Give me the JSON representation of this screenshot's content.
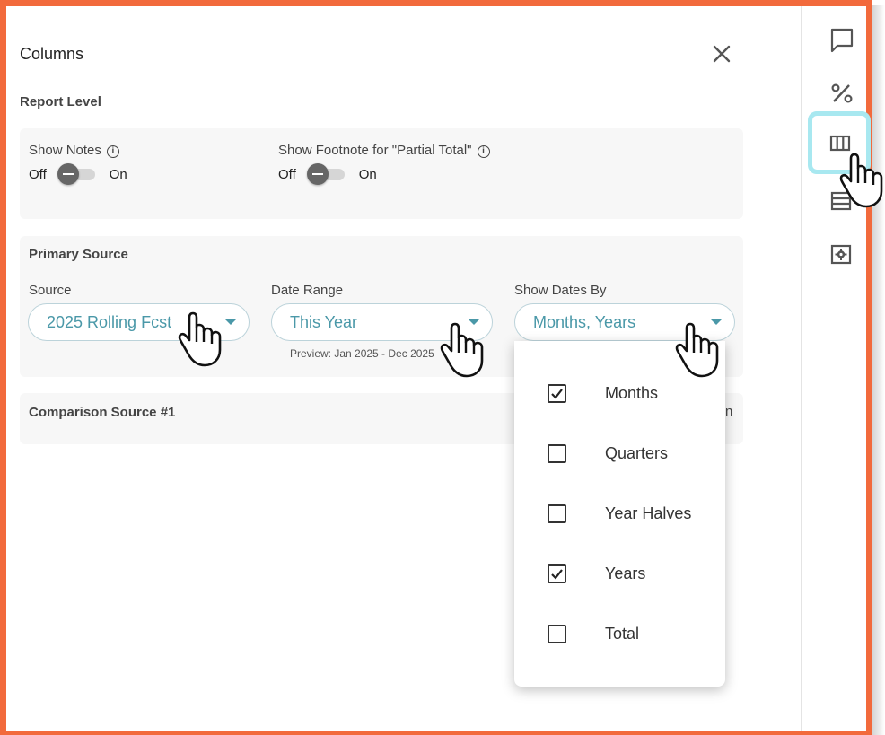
{
  "panel": {
    "title": "Columns",
    "close_icon": "close-icon"
  },
  "report_level": {
    "label": "Report Level",
    "show_notes": {
      "label": "Show Notes",
      "off_label": "Off",
      "on_label": "On",
      "state": "off"
    },
    "show_footnote": {
      "label": "Show Footnote for \"Partial Total\"",
      "off_label": "Off",
      "on_label": "On",
      "state": "off"
    }
  },
  "primary_source": {
    "label": "Primary Source",
    "source": {
      "label": "Source",
      "value": "2025 Rolling Fcst"
    },
    "date_range": {
      "label": "Date Range",
      "value": "This Year",
      "preview": "Preview: Jan 2025 - Dec 2025"
    },
    "show_dates_by": {
      "label": "Show Dates By",
      "value": "Months, Years"
    }
  },
  "comparison_source": {
    "label": "Comparison Source #1",
    "truncated_text": "n"
  },
  "dates_dropdown": {
    "options": [
      {
        "label": "Months",
        "checked": true
      },
      {
        "label": "Quarters",
        "checked": false
      },
      {
        "label": "Year Halves",
        "checked": false
      },
      {
        "label": "Years",
        "checked": true
      },
      {
        "label": "Total",
        "checked": false
      }
    ]
  },
  "sidebar": {
    "items": [
      {
        "icon": "comment-icon",
        "active": false
      },
      {
        "icon": "percent-icon",
        "active": false
      },
      {
        "icon": "columns-icon",
        "active": true
      },
      {
        "icon": "rows-icon",
        "active": false
      },
      {
        "icon": "settings-icon",
        "active": false
      }
    ]
  },
  "colors": {
    "frame_border": "#f26a3c",
    "accent_teal": "#4a98a8",
    "active_highlight": "#a8e8f0",
    "card_background": "#f7f7f7"
  }
}
